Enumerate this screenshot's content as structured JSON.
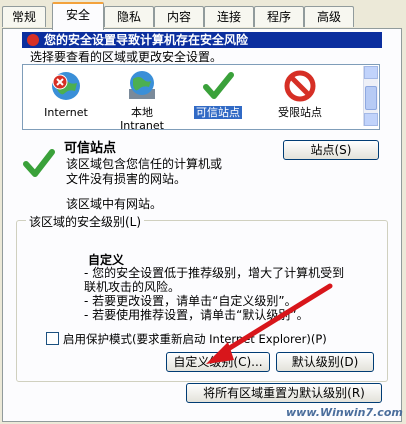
{
  "tabs": [
    "常规",
    "安全",
    "隐私",
    "内容",
    "连接",
    "程序",
    "高级"
  ],
  "banner": {
    "text": "您的安全设置导致计算机存在安全风险"
  },
  "zone_hint": "选择要查看的区域或更改安全设置。",
  "zones": [
    {
      "label": "Internet",
      "icon": "globe-warning-icon"
    },
    {
      "label": "本地\nIntranet",
      "icon": "intranet-globe-icon"
    },
    {
      "label": "可信站点",
      "icon": "checkmark-icon"
    },
    {
      "label": "受限站点",
      "icon": "restricted-icon"
    }
  ],
  "trusted": {
    "title": "可信站点",
    "desc": "该区域包含您信任的计算机或\n文件没有损害的网站。",
    "no_sites": "该区域中有网站。",
    "sites_button": "站点(S)"
  },
  "security_level": {
    "group_label": "该区域的安全级别(L)",
    "title": "自定义",
    "desc": "- 您的安全设置低于推荐级别，增大了计算机受到\n  联机攻击的风险。\n- 若要更改设置，请单击“自定义级别”。\n- 若要使用推荐设置，请单击“默认级别”。"
  },
  "protected_mode": "启用保护模式(要求重新启动 Internet Explorer)(P)",
  "buttons": {
    "custom": "自定义级别(C)...",
    "default": "默认级别(D)",
    "reset_all": "将所有区域重置为默认级别(R)"
  },
  "watermark": "www.Winwin7.com",
  "colors": {
    "banner": "#0b2e9e",
    "selection": "#316ac5",
    "arrow": "#d8161b"
  }
}
